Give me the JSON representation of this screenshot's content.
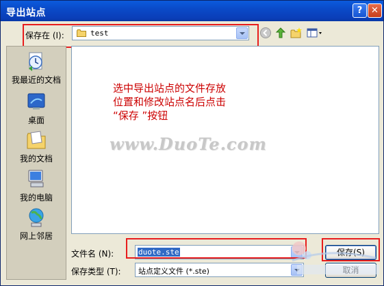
{
  "window": {
    "title": "导出站点",
    "help_glyph": "?",
    "close_glyph": "✕"
  },
  "save_in": {
    "label": "保存在 (I):",
    "value": "test"
  },
  "places": [
    {
      "label": "我最近的文档",
      "icon": "recent-documents-icon"
    },
    {
      "label": "桌面",
      "icon": "desktop-icon"
    },
    {
      "label": "我的文档",
      "icon": "my-documents-icon"
    },
    {
      "label": "我的电脑",
      "icon": "my-computer-icon"
    },
    {
      "label": "网上邻居",
      "icon": "network-places-icon"
    }
  ],
  "instruction": {
    "line1": "选中导出站点的文件存放",
    "line2": "位置和修改站点名后点击",
    "line3": "“保存 ”按钮"
  },
  "watermark": "www.DuoTe.com",
  "file_name": {
    "label": "文件名 (N):",
    "value": "duote.ste"
  },
  "file_type": {
    "label": "保存类型 (T):",
    "value": "站点定义文件 (*.ste)"
  },
  "buttons": {
    "save": "保存(S)",
    "cancel": "取消"
  },
  "colors": {
    "highlight_box": "#e81c1c",
    "instruction_text": "#cc0000",
    "titlebar": "#0a4ac8"
  }
}
